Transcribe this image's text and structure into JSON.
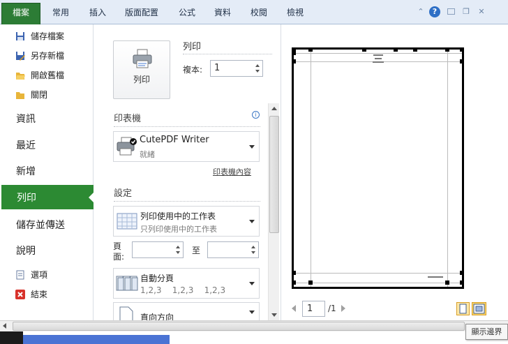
{
  "ribbon": {
    "file_tab": "檔案",
    "tabs": [
      "常用",
      "插入",
      "版面配置",
      "公式",
      "資料",
      "校閱",
      "檢視"
    ],
    "help": "?"
  },
  "backstage": {
    "commands": [
      {
        "label": "儲存檔案",
        "icon": "save-icon"
      },
      {
        "label": "另存新檔",
        "icon": "save-as-icon"
      },
      {
        "label": "開啟舊檔",
        "icon": "open-folder-icon"
      },
      {
        "label": "關閉",
        "icon": "close-folder-icon"
      }
    ],
    "nav": [
      "資訊",
      "最近",
      "新增",
      "列印",
      "儲存並傳送",
      "說明"
    ],
    "active": "列印",
    "options_label": "選項",
    "exit_label": "結束"
  },
  "print": {
    "section_title": "列印",
    "button_label": "列印",
    "copies_label": "複本:",
    "copies_value": "1",
    "printer_header": "印表機",
    "printer_name": "CutePDF Writer",
    "printer_status": "就緒",
    "printer_properties": "印表機內容",
    "settings_header": "設定",
    "what_main": "列印使用中的工作表",
    "what_sub": "只列印使用中的工作表",
    "pages_label": "頁面:",
    "pages_to": "至",
    "collate_main": "自動分頁",
    "collate_sub": "1,2,3    1,2,3    1,2,3",
    "orientation_main": "直向方向"
  },
  "preview": {
    "page_value": "1",
    "page_total": "/1",
    "tooltip": "顯示邊界"
  },
  "colors": {
    "accent_green": "#2c8a33",
    "ribbon_bg": "#e4ecf7"
  }
}
